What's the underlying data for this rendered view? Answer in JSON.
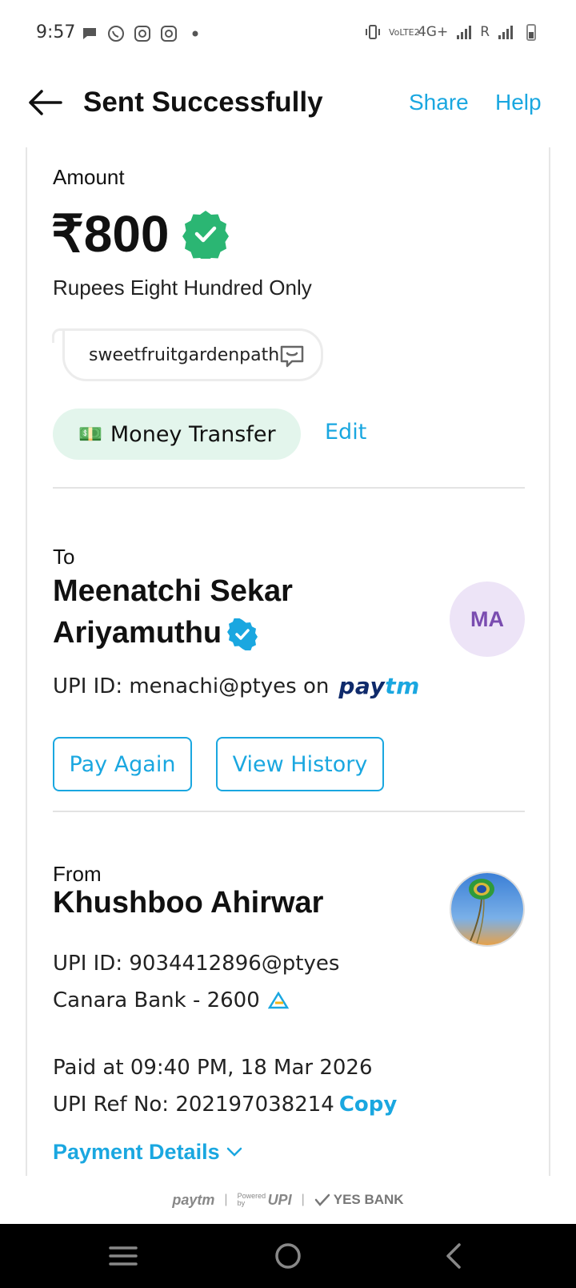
{
  "status_bar": {
    "time": "9:57",
    "left_icons": [
      "chat-bubble-icon",
      "whatsapp-icon",
      "instagram-icon",
      "instagram-icon",
      "dot-icon"
    ],
    "right_text_1": "VoLTE2",
    "right_text_2": "4G+",
    "right_text_3": "R"
  },
  "header": {
    "title": "Sent Successfully",
    "share_label": "Share",
    "help_label": "Help"
  },
  "amount_section": {
    "label": "Amount",
    "value": "₹800",
    "in_words": "Rupees Eight Hundred Only",
    "note": "sweetfruitgardenpath",
    "category_emoji": "💵",
    "category": "Money Transfer",
    "edit_label": "Edit"
  },
  "to_section": {
    "label": "To",
    "name": "Meenatchi Sekar Ariyamuthu",
    "initials": "MA",
    "upi_text": "UPI ID: menachi@ptyes on",
    "paytm_pay": "pay",
    "paytm_tm": "tm",
    "pay_again_label": "Pay Again",
    "view_history_label": "View History"
  },
  "from_section": {
    "label": "From",
    "name": "Khushboo Ahirwar",
    "upi_text": "UPI ID: 9034412896@ptyes",
    "bank_text": "Canara Bank - 2600"
  },
  "transaction": {
    "paid_at": "Paid at 09:40 PM, 18 Mar 2026",
    "ref_text": "UPI Ref No: 202197038214",
    "copy_label": "Copy",
    "payment_details_label": "Payment Details"
  },
  "footer": {
    "paytm": "paytm",
    "powered_by": "Powered by",
    "upi": "UPI",
    "bank": "YES BANK"
  },
  "colors": {
    "accent": "#1aa7e0",
    "verified_green": "#2bb673",
    "verified_blue": "#1aa7e0",
    "tag_bg": "#e3f5ec",
    "avatar_bg": "#ede4f7"
  }
}
